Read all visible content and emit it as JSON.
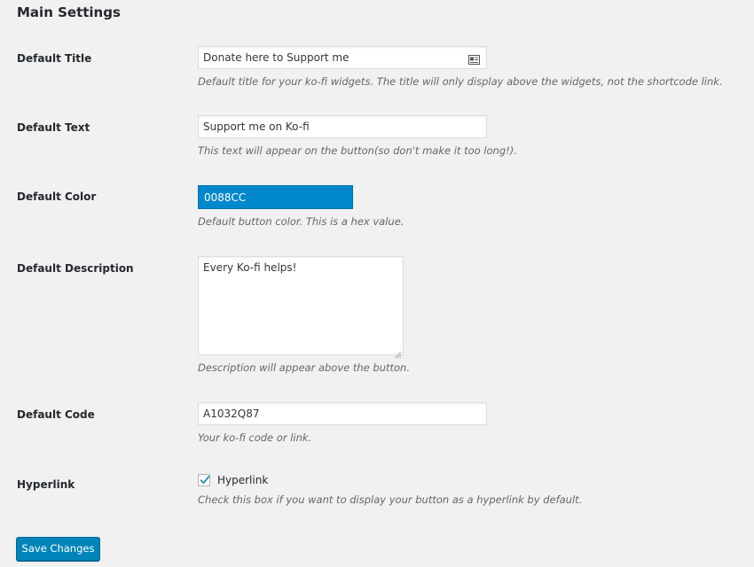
{
  "page": {
    "title": "Main Settings"
  },
  "fields": {
    "default_title": {
      "label": "Default Title",
      "value": "Donate here to Support me",
      "description": "Default title for your ko-fi widgets. The title will only display above the widgets, not the shortcode link."
    },
    "default_text": {
      "label": "Default Text",
      "value": "Support me on Ko-fi",
      "description": "This text will appear on the button(so don't make it too long!)."
    },
    "default_color": {
      "label": "Default Color",
      "value": "0088CC",
      "description": "Default button color. This is a hex value.",
      "swatch": "#0088CC"
    },
    "default_description": {
      "label": "Default Description",
      "value": "Every Ko-fi helps!",
      "description": "Description will appear above the button."
    },
    "default_code": {
      "label": "Default Code",
      "value": "A1032Q87",
      "description": "Your ko-fi code or link."
    },
    "hyperlink": {
      "label": "Hyperlink",
      "checkbox_label": "Hyperlink",
      "checked": true,
      "description": "Check this box if you want to display your button as a hyperlink by default."
    }
  },
  "actions": {
    "save_label": "Save Changes"
  },
  "colors": {
    "primary_button": "#0085BA",
    "background": "#F1F1F1"
  },
  "icons": {
    "title_field_icon": "contact-card-icon",
    "checkbox_icon": "checkmark-icon",
    "textarea_grip": "resize-grip-icon"
  }
}
